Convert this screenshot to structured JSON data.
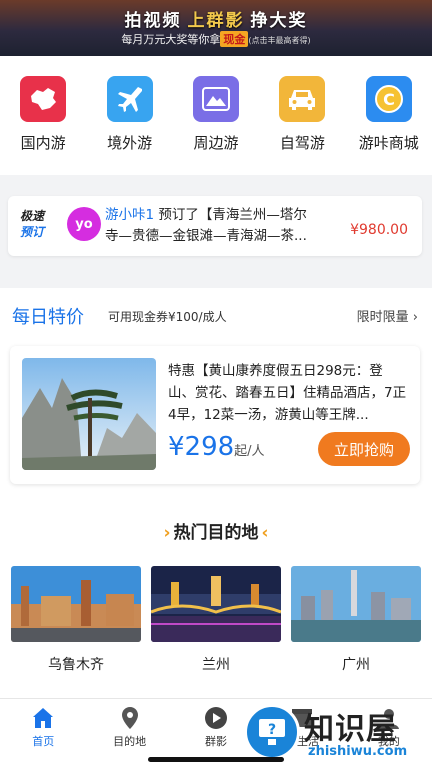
{
  "banner": {
    "title_a": "拍视频",
    "title_hl": "上群影",
    "title_b": "挣大奖",
    "sub_a": "每月万元大奖等你拿",
    "sub_cash": "现金",
    "sub_small": "(点击丰最高者得)"
  },
  "categories": [
    {
      "label": "国内游",
      "icon": "china-map-icon",
      "color": "#e8314a"
    },
    {
      "label": "境外游",
      "icon": "airplane-icon",
      "color": "#38a4f0"
    },
    {
      "label": "周边游",
      "icon": "mountain-icon",
      "color": "#7a6ee6"
    },
    {
      "label": "自驾游",
      "icon": "car-icon",
      "color": "#f2b63a"
    },
    {
      "label": "游咔商城",
      "icon": "coin-icon",
      "color": "#2c8cf0"
    }
  ],
  "news": {
    "badge_line1": "极速",
    "badge_line2": "预订",
    "avatar_text": "yo",
    "user": "游小咔1",
    "line1": " 预订了【青海兰州—塔尔",
    "line2": "寺—贵德—金银滩—青海湖—茶...",
    "price": "¥980.00"
  },
  "daily": {
    "title": "每日特价",
    "subtitle": "可用现金券¥100/成人",
    "more": "限时限量",
    "deal_text": "特惠【黄山康养度假五日298元：登山、赏花、踏春五日】住精品酒店，7正4早，12菜一汤，游黄山等王牌...",
    "price": "¥298",
    "price_unit": "起/人",
    "buy_label": "立即抢购"
  },
  "hot": {
    "title": "热门目的地",
    "destinations": [
      {
        "name": "乌鲁木齐"
      },
      {
        "name": "兰州"
      },
      {
        "name": "广州"
      }
    ]
  },
  "tabs": [
    {
      "label": "首页",
      "icon": "home-icon",
      "active": true
    },
    {
      "label": "目的地",
      "icon": "location-pin-icon",
      "active": false
    },
    {
      "label": "群影",
      "icon": "play-icon",
      "active": false
    },
    {
      "label": "地生活",
      "icon": "shop-icon",
      "active": false
    },
    {
      "label": "我的",
      "icon": "user-icon",
      "active": false
    }
  ],
  "watermark": {
    "zh": "知识屋",
    "en": "zhishiwu.com"
  },
  "colors": {
    "accent": "#1a73e8",
    "price": "#e03a2f",
    "buy": "#f07a1f"
  }
}
